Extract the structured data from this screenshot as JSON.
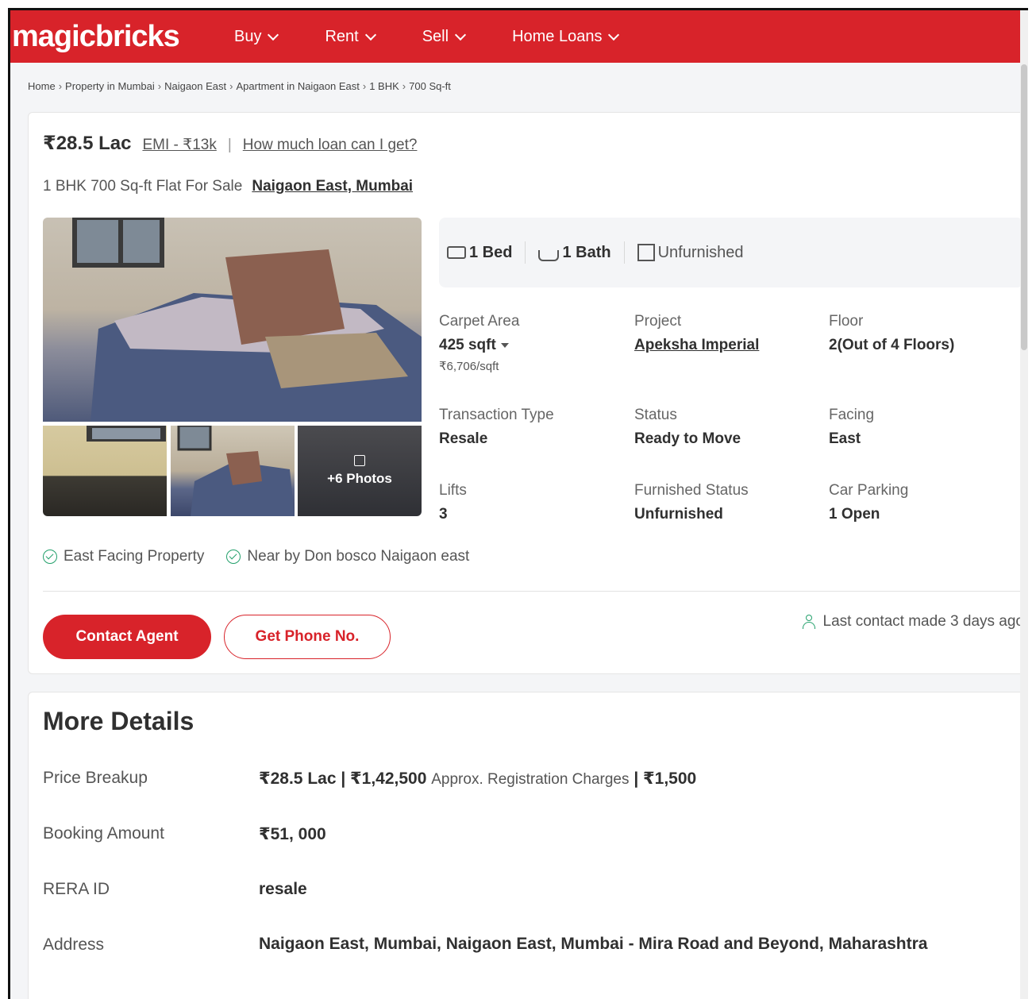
{
  "header": {
    "logo": "magicbricks",
    "nav": [
      "Buy",
      "Rent",
      "Sell",
      "Home Loans"
    ]
  },
  "breadcrumb": [
    "Home",
    "Property in Mumbai",
    "Naigaon East",
    "Apartment in Naigaon East",
    "1 BHK",
    "700 Sq-ft"
  ],
  "listing": {
    "price": "₹28.5 Lac",
    "emi": "EMI - ₹13k",
    "loan_link": "How much loan can I get?",
    "title": "1 BHK 700 Sq-ft Flat For Sale",
    "location": "Naigaon East, Mumbai",
    "photos_more": "+6 Photos",
    "summary": {
      "bed": "1 Bed",
      "bath": "1 Bath",
      "furnishing": "Unfurnished"
    },
    "details": {
      "carpet_area_label": "Carpet Area",
      "carpet_area_value": "425 sqft",
      "carpet_area_rate": "₹6,706/sqft",
      "project_label": "Project",
      "project_value": "Apeksha Imperial",
      "floor_label": "Floor",
      "floor_value": "2(Out of 4 Floors)",
      "transaction_label": "Transaction Type",
      "transaction_value": "Resale",
      "status_label": "Status",
      "status_value": "Ready to Move",
      "facing_label": "Facing",
      "facing_value": "East",
      "lifts_label": "Lifts",
      "lifts_value": "3",
      "furnished_label": "Furnished Status",
      "furnished_value": "Unfurnished",
      "parking_label": "Car Parking",
      "parking_value": "1 Open"
    },
    "highlights": [
      "East Facing Property",
      "Near by Don bosco Naigaon east"
    ],
    "contact_button": "Contact Agent",
    "phone_button": "Get Phone No.",
    "last_contact": "Last contact made 3 days ago"
  },
  "more_details": {
    "heading": "More Details",
    "price_breakup_label": "Price Breakup",
    "price_breakup_value": "₹28.5 Lac | ₹1,42,500",
    "price_breakup_note": "Approx. Registration Charges",
    "price_breakup_extra": "| ₹1,500",
    "booking_label": "Booking Amount",
    "booking_value": "₹51, 000",
    "rera_label": "RERA ID",
    "rera_value": "resale",
    "address_label": "Address",
    "address_value": "Naigaon East, Mumbai, Naigaon East, Mumbai - Mira Road and Beyond, Maharashtra"
  }
}
